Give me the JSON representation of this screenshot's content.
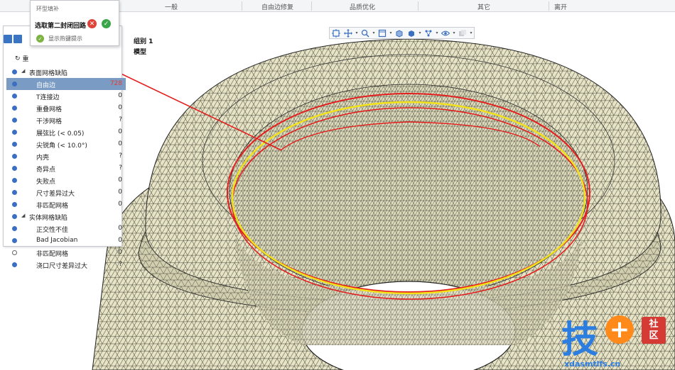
{
  "ribbon": {
    "groups": [
      "一般",
      "自由边修复",
      "品质优化",
      "其它",
      "离开"
    ]
  },
  "viewport": {
    "group_label": "组别 1",
    "model_label": "模型",
    "toolbar_icons": [
      "view-cube-icon",
      "pan-icon",
      "zoom-icon",
      "window-icon",
      "box-icon",
      "solid-view-icon",
      "mesh-display-icon",
      "visibility-icon",
      "transparency-icon"
    ]
  },
  "panel": {
    "refresh_label": "重",
    "tree": [
      {
        "kind": "category",
        "label": "表面网格缺陷",
        "count": "",
        "visible": true
      },
      {
        "kind": "item",
        "label": "自由边",
        "count": "728",
        "visible": true,
        "selected": true,
        "alert": true
      },
      {
        "kind": "item",
        "label": "T连接边",
        "count": "0",
        "visible": true
      },
      {
        "kind": "item",
        "label": "重叠网格",
        "count": "0",
        "visible": true
      },
      {
        "kind": "item",
        "label": "干涉网格",
        "count": "?",
        "visible": true
      },
      {
        "kind": "item",
        "label": "展弦比 (< 0.05)",
        "count": "0",
        "visible": true
      },
      {
        "kind": "item",
        "label": "尖锐角 (< 10.0°)",
        "count": "0",
        "visible": true
      },
      {
        "kind": "item",
        "label": "内壳",
        "count": "?",
        "visible": true
      },
      {
        "kind": "item",
        "label": "奇异点",
        "count": "?",
        "visible": true
      },
      {
        "kind": "item",
        "label": "失败点",
        "count": "0",
        "visible": true
      },
      {
        "kind": "item",
        "label": "尺寸差异过大",
        "count": "0",
        "visible": true
      },
      {
        "kind": "item",
        "label": "非匹配网格",
        "count": "0",
        "visible": true
      },
      {
        "kind": "category",
        "label": "实体网格缺陷",
        "count": "",
        "visible": true
      },
      {
        "kind": "item",
        "label": "正交性不佳",
        "count": "0",
        "visible": true
      },
      {
        "kind": "item",
        "label": "Bad Jacobian",
        "count": "0",
        "visible": true
      },
      {
        "kind": "item",
        "label": "非匹配网格",
        "count": "0",
        "visible": false
      },
      {
        "kind": "item",
        "label": "浇口尺寸差异过大",
        "count": "?",
        "visible": true
      }
    ]
  },
  "popup": {
    "title": "环型填补",
    "prompt": "选取第二封闭回路",
    "cancel_symbol": "✕",
    "ok_symbol": "✓",
    "hint_label": "显示热键提示",
    "hint_symbol": "✓"
  },
  "watermark": {
    "main": "技",
    "plus": "+",
    "badge_top": "社",
    "badge_bottom": "区",
    "url": "xdasmtlfs.cn"
  },
  "colors": {
    "mesh_fill": "#e6e3c6",
    "mesh_line": "#4a4a3a",
    "loop_red": "#e41e1e",
    "loop_yellow": "#f2e21a",
    "selection_blue": "#7a9cc4",
    "accent": "#3b6fc2"
  }
}
